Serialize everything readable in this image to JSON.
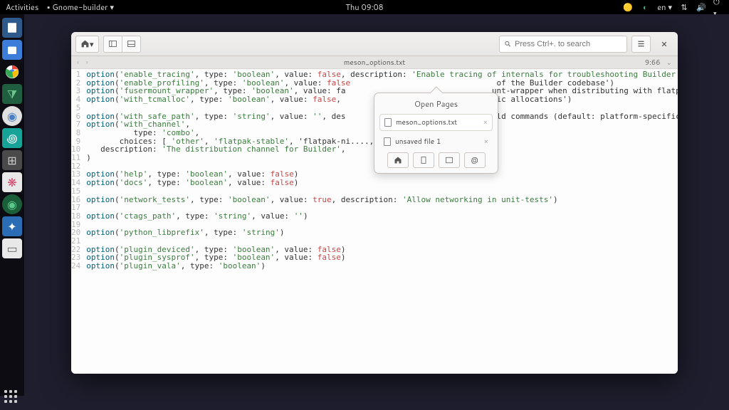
{
  "topbar": {
    "activities": "Activities",
    "app_menu": "Gnome-builder",
    "clock": "Thu 09:08",
    "lang": "en"
  },
  "window": {
    "search_placeholder": "Press Ctrl+. to search",
    "tab_title": "meson_options.txt",
    "cursor": "9:66"
  },
  "popover": {
    "title": "Open Pages",
    "items": [
      "meson_options.txt",
      "unsaved file 1"
    ]
  },
  "code": [
    {
      "n": 1,
      "t": "option('enable_tracing', type: 'boolean', value: false, description: 'Enable tracing of internals for troubleshooting Builder')"
    },
    {
      "n": 2,
      "t": "option('enable_profiling', type: 'boolean', value: false                               of the Builder codebase')"
    },
    {
      "n": 3,
      "t": "option('fusermount_wrapper', type: 'boolean', value: fa                               unt-wrapper when distributing with flatpak')"
    },
    {
      "n": 4,
      "t": "option('with_tcmalloc', type: 'boolean', value: false,                               amic allocations')"
    },
    {
      "n": 5,
      "t": ""
    },
    {
      "n": 6,
      "t": "option('with_safe_path', type: 'string', value: '', des                               ild commands (default: platform-specific)')"
    },
    {
      "n": 7,
      "t": "option('with_channel',"
    },
    {
      "n": 8,
      "t": "          type: 'combo',"
    },
    {
      "n": 9,
      "t": "       choices: [ 'other', 'flatpak-stable', 'flatpak-ni...., ,,"
    },
    {
      "n": 10,
      "t": "   description: 'The distribution channel for Builder',"
    },
    {
      "n": 11,
      "t": ")"
    },
    {
      "n": 12,
      "t": ""
    },
    {
      "n": 13,
      "t": "option('help', type: 'boolean', value: false)"
    },
    {
      "n": 14,
      "t": "option('docs', type: 'boolean', value: false)"
    },
    {
      "n": 15,
      "t": ""
    },
    {
      "n": 16,
      "t": "option('network_tests', type: 'boolean', value: true, description: 'Allow networking in unit-tests')"
    },
    {
      "n": 17,
      "t": ""
    },
    {
      "n": 18,
      "t": "option('ctags_path', type: 'string', value: '')"
    },
    {
      "n": 19,
      "t": ""
    },
    {
      "n": 20,
      "t": "option('python_libprefix', type: 'string')"
    },
    {
      "n": 21,
      "t": ""
    },
    {
      "n": 22,
      "t": "option('plugin_deviced', type: 'boolean', value: false)"
    },
    {
      "n": 23,
      "t": "option('plugin_sysprof', type: 'boolean', value: false)"
    },
    {
      "n": 24,
      "t": "option('plugin_vala', type: 'boolean')"
    }
  ]
}
